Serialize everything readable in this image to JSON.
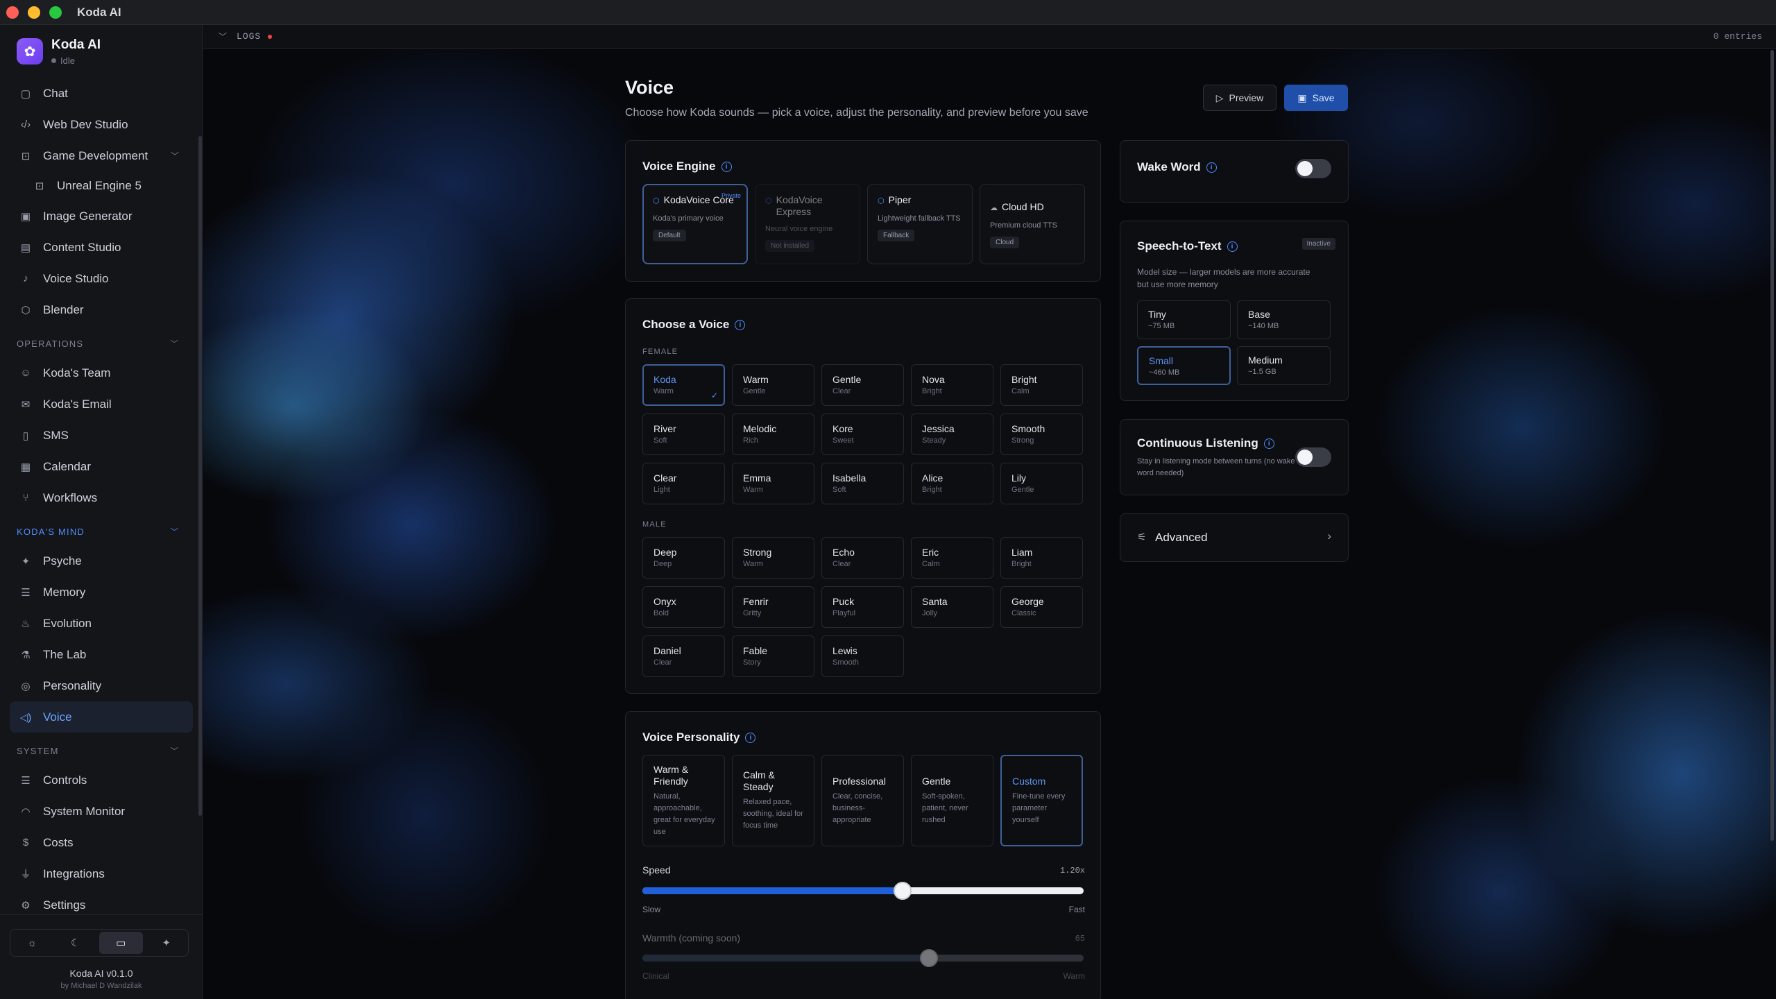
{
  "window": {
    "title": "Koda AI"
  },
  "sidebar": {
    "brand_name": "Koda AI",
    "brand_status": "Idle",
    "items_top": [
      {
        "label": "Chat",
        "icon": "chat-icon",
        "glyph": "▢"
      },
      {
        "label": "Web Dev Studio",
        "icon": "code-icon",
        "glyph": "‹/›"
      },
      {
        "label": "Game Development",
        "icon": "gamepad-icon",
        "glyph": "⊡"
      },
      {
        "label": "Unreal Engine 5",
        "icon": "gamepad-icon",
        "glyph": "⊡"
      },
      {
        "label": "Image Generator",
        "icon": "image-icon",
        "glyph": "▣"
      },
      {
        "label": "Content Studio",
        "icon": "document-icon",
        "glyph": "▤"
      },
      {
        "label": "Voice Studio",
        "icon": "microphone-icon",
        "glyph": "♪"
      },
      {
        "label": "Blender",
        "icon": "cube-icon",
        "glyph": "⬡"
      }
    ],
    "section_operations": "OPERATIONS",
    "items_operations": [
      {
        "label": "Koda's Team",
        "icon": "users-icon",
        "glyph": "☺"
      },
      {
        "label": "Koda's Email",
        "icon": "mail-icon",
        "glyph": "✉"
      },
      {
        "label": "SMS",
        "icon": "phone-icon",
        "glyph": "▯"
      },
      {
        "label": "Calendar",
        "icon": "calendar-icon",
        "glyph": "▦"
      },
      {
        "label": "Workflows",
        "icon": "workflow-icon",
        "glyph": "⑂"
      }
    ],
    "section_mind": "KODA'S MIND",
    "items_mind": [
      {
        "label": "Psyche",
        "icon": "sparkles-icon",
        "glyph": "✦"
      },
      {
        "label": "Memory",
        "icon": "database-icon",
        "glyph": "☰"
      },
      {
        "label": "Evolution",
        "icon": "flame-icon",
        "glyph": "♨"
      },
      {
        "label": "The Lab",
        "icon": "flask-icon",
        "glyph": "⚗"
      },
      {
        "label": "Personality",
        "icon": "fingerprint-icon",
        "glyph": "◎"
      },
      {
        "label": "Voice",
        "icon": "speaker-icon",
        "glyph": "◁)"
      }
    ],
    "section_system": "SYSTEM",
    "items_system": [
      {
        "label": "Controls",
        "icon": "sliders-icon",
        "glyph": "☰"
      },
      {
        "label": "System Monitor",
        "icon": "gauge-icon",
        "glyph": "◠"
      },
      {
        "label": "Costs",
        "icon": "dollar-icon",
        "glyph": "$"
      },
      {
        "label": "Integrations",
        "icon": "plug-icon",
        "glyph": "⏚"
      },
      {
        "label": "Settings",
        "icon": "gear-icon",
        "glyph": "⚙"
      }
    ],
    "theme_options": [
      "☼",
      "☾",
      "▭",
      "✦"
    ],
    "version": "Koda AI v0.1.0",
    "byline": "by Michael D Wandzilak"
  },
  "logs": {
    "label": "LOGS",
    "entries": "0 entries"
  },
  "page": {
    "title": "Voice",
    "subtitle": "Choose how Koda sounds — pick a voice, adjust the personality, and preview before you save",
    "preview_label": "Preview",
    "save_label": "Save"
  },
  "engine": {
    "title": "Voice Engine",
    "options": [
      {
        "name": "KodaVoice Core",
        "desc": "Koda's primary voice",
        "badge": "Default",
        "private": "Private",
        "selected": true
      },
      {
        "name": "KodaVoice Express",
        "desc": "Neural voice engine",
        "badge": "Not installed",
        "dim": true
      },
      {
        "name": "Piper",
        "desc": "Lightweight fallback TTS",
        "badge": "Fallback"
      },
      {
        "name": "Cloud HD",
        "desc": "Premium cloud TTS",
        "badge": "Cloud"
      }
    ]
  },
  "voices": {
    "title": "Choose a Voice",
    "female_label": "FEMALE",
    "male_label": "MALE",
    "female": [
      {
        "name": "Koda",
        "tone": "Warm",
        "selected": true
      },
      {
        "name": "Warm",
        "tone": "Gentle"
      },
      {
        "name": "Gentle",
        "tone": "Clear"
      },
      {
        "name": "Nova",
        "tone": "Bright"
      },
      {
        "name": "Bright",
        "tone": "Calm"
      },
      {
        "name": "River",
        "tone": "Soft"
      },
      {
        "name": "Melodic",
        "tone": "Rich"
      },
      {
        "name": "Kore",
        "tone": "Sweet"
      },
      {
        "name": "Jessica",
        "tone": "Steady"
      },
      {
        "name": "Smooth",
        "tone": "Strong"
      },
      {
        "name": "Clear",
        "tone": "Light"
      },
      {
        "name": "Emma",
        "tone": "Warm"
      },
      {
        "name": "Isabella",
        "tone": "Soft"
      },
      {
        "name": "Alice",
        "tone": "Bright"
      },
      {
        "name": "Lily",
        "tone": "Gentle"
      }
    ],
    "male": [
      {
        "name": "Deep",
        "tone": "Deep"
      },
      {
        "name": "Strong",
        "tone": "Warm"
      },
      {
        "name": "Echo",
        "tone": "Clear"
      },
      {
        "name": "Eric",
        "tone": "Calm"
      },
      {
        "name": "Liam",
        "tone": "Bright"
      },
      {
        "name": "Onyx",
        "tone": "Bold"
      },
      {
        "name": "Fenrir",
        "tone": "Gritty"
      },
      {
        "name": "Puck",
        "tone": "Playful"
      },
      {
        "name": "Santa",
        "tone": "Jolly"
      },
      {
        "name": "George",
        "tone": "Classic"
      },
      {
        "name": "Daniel",
        "tone": "Clear"
      },
      {
        "name": "Fable",
        "tone": "Story"
      },
      {
        "name": "Lewis",
        "tone": "Smooth"
      }
    ]
  },
  "personality": {
    "title": "Voice Personality",
    "options": [
      {
        "name": "Warm & Friendly",
        "desc": "Natural, approachable, great for everyday use"
      },
      {
        "name": "Calm & Steady",
        "desc": "Relaxed pace, soothing, ideal for focus time"
      },
      {
        "name": "Professional",
        "desc": "Clear, concise, business-appropriate"
      },
      {
        "name": "Gentle",
        "desc": "Soft-spoken, patient, never rushed"
      },
      {
        "name": "Custom",
        "desc": "Fine-tune every parameter yourself",
        "selected": true
      }
    ],
    "speed": {
      "label": "Speed",
      "value_text": "1.20x",
      "fraction": 0.59,
      "min_label": "Slow",
      "max_label": "Fast"
    },
    "warmth": {
      "label": "Warmth (coming soon)",
      "value_text": "65",
      "fraction": 0.65,
      "min_label": "Clinical",
      "max_label": "Warm"
    }
  },
  "wake_word": {
    "title": "Wake Word",
    "enabled": false
  },
  "stt": {
    "title": "Speech-to-Text",
    "status": "Inactive",
    "desc": "Model size — larger models are more accurate but use more memory",
    "models": [
      {
        "name": "Tiny",
        "size": "~75 MB"
      },
      {
        "name": "Base",
        "size": "~140 MB"
      },
      {
        "name": "Small",
        "size": "~460 MB",
        "selected": true
      },
      {
        "name": "Medium",
        "size": "~1.5 GB"
      }
    ]
  },
  "continuous": {
    "title": "Continuous Listening",
    "desc": "Stay in listening mode between turns (no wake word needed)",
    "enabled": false
  },
  "advanced": {
    "label": "Advanced"
  }
}
